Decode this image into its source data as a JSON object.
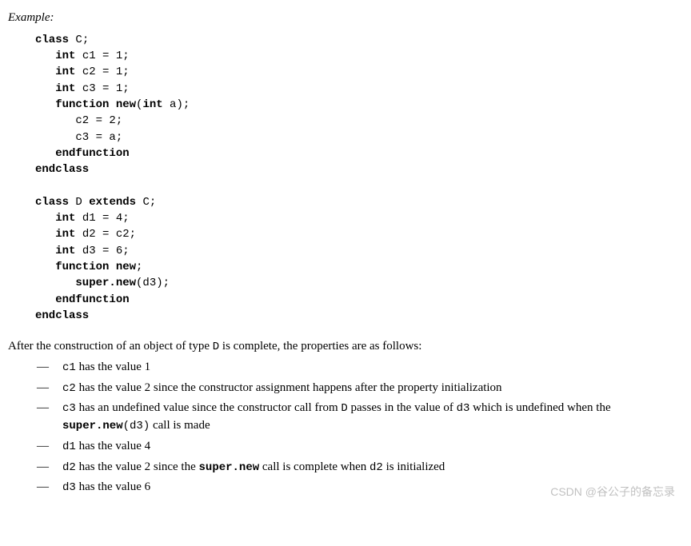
{
  "example_label": "Example:",
  "code": {
    "l1": "class",
    "l1b": " C;",
    "l2": "   int",
    "l2b": " c1 = 1;",
    "l3": "   int",
    "l3b": " c2 = 1;",
    "l4": "   int",
    "l4b": " c3 = 1;",
    "l5": "   function new",
    "l5b": "(",
    "l5c": "int",
    "l5d": " a);",
    "l6": "      c2 = 2;",
    "l7": "      c3 = a;",
    "l8": "   endfunction",
    "l9": "endclass",
    "blank1": "",
    "l10": "class",
    "l10b": " D ",
    "l10c": "extends",
    "l10d": " C;",
    "l11": "   int",
    "l11b": " d1 = 4;",
    "l12": "   int",
    "l12b": " d2 = c2;",
    "l13": "   int",
    "l13b": " d3 = 6;",
    "l14": "   function new",
    "l14b": ";",
    "l15": "      super.new",
    "l15b": "(d3);",
    "l16": "   endfunction",
    "l17": "endclass"
  },
  "intro_before": "After the construction of an object of type ",
  "intro_code1": "D",
  "intro_after": " is complete, the properties are as follows:",
  "dash": "—",
  "items": {
    "i1_a": "c1",
    "i1_b": " has the value 1",
    "i2_a": "c2",
    "i2_b": " has the value 2 since the constructor assignment happens after the property initialization",
    "i3_a": "c3",
    "i3_b": " has an undefined value since the constructor call from ",
    "i3_c": "D",
    "i3_d": " passes in the value of ",
    "i3_e": "d3",
    "i3_f": " which is undefined when the ",
    "i3_g": "super.new",
    "i3_h": "(d3)",
    "i3_i": " call is made",
    "i4_a": "d1",
    "i4_b": " has the value 4",
    "i5_a": "d2",
    "i5_b": " has the value 2 since the ",
    "i5_c": "super.new",
    "i5_d": " call is complete when ",
    "i5_e": "d2",
    "i5_f": " is initialized",
    "i6_a": "d3",
    "i6_b": " has the value 6"
  },
  "watermark": "CSDN @谷公子的备忘录"
}
